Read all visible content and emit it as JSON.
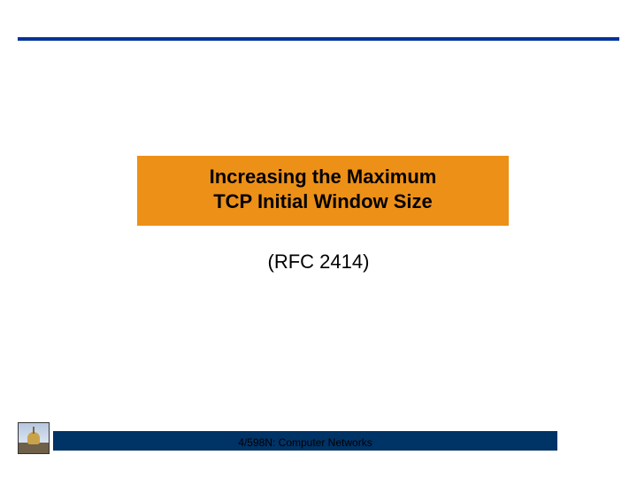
{
  "title": {
    "line1": "Increasing the Maximum",
    "line2": "TCP Initial Window Size"
  },
  "subtitle": "(RFC 2414)",
  "footer": "4/598N: Computer Networks"
}
